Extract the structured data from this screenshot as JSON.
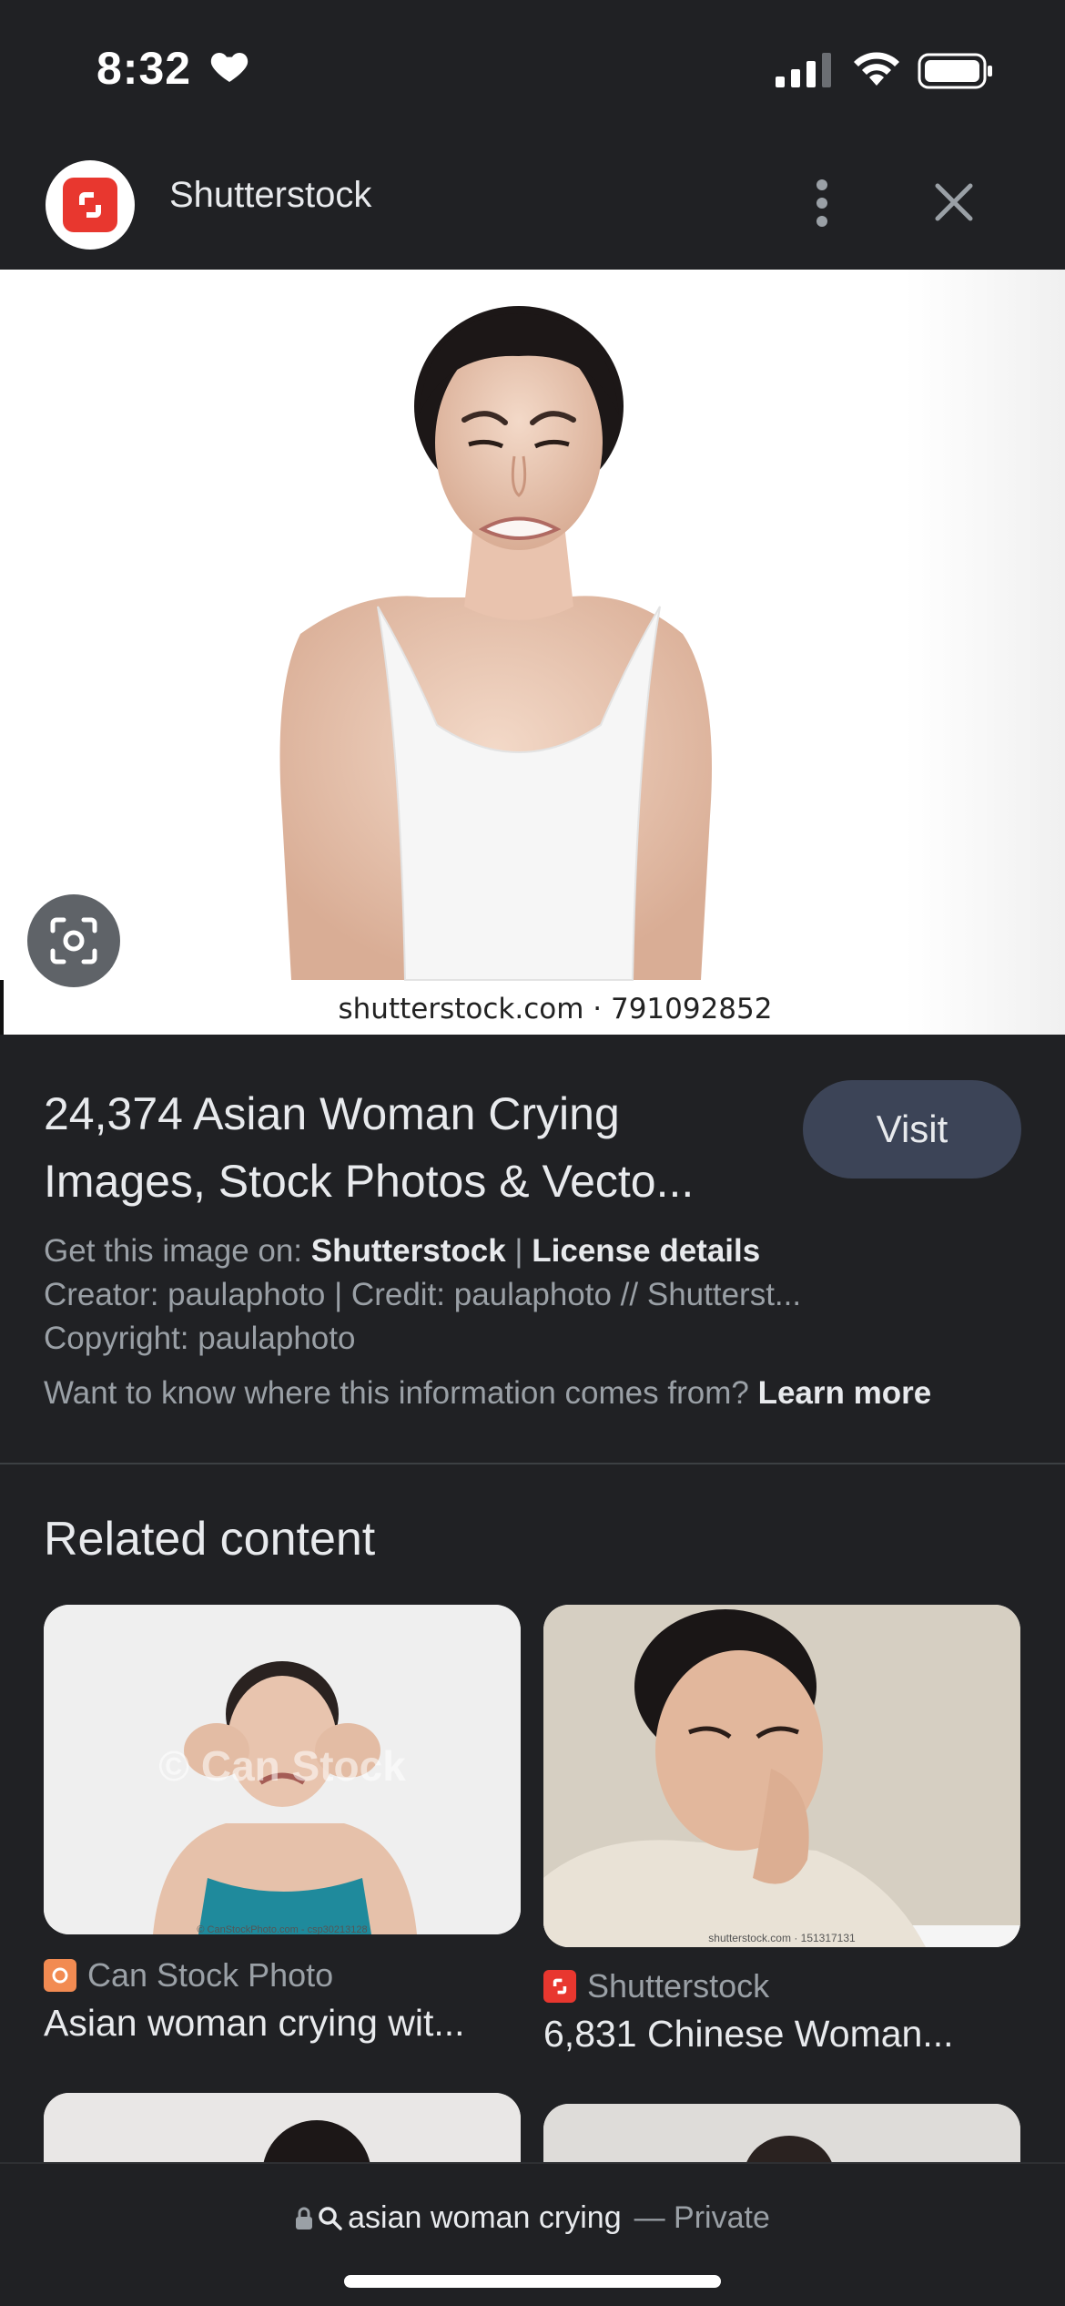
{
  "status_bar": {
    "time": "8:32",
    "icons": [
      "heart-icon",
      "signal-icon",
      "wifi-icon",
      "battery-icon"
    ]
  },
  "header": {
    "site_name": "Shutterstock",
    "logo_icon": "shutterstock-logo-icon",
    "more_icon": "more-vertical-icon",
    "close_icon": "close-icon"
  },
  "hero": {
    "watermark": "shutterstock.com · 791092852",
    "lens_icon": "lens-search-icon"
  },
  "result": {
    "title_line1": "24,374 Asian Woman Crying",
    "title_line2": "Images, Stock Photos & Vecto...",
    "visit_label": "Visit",
    "get_image_prefix": "Get this image on: ",
    "get_image_source": "Shutterstock",
    "separator": " | ",
    "license_label": "License details",
    "creator_line": "Creator: paulaphoto | Credit: paulaphoto // Shutterst...",
    "copyright_line": "Copyright: paulaphoto",
    "info_question": "Want to know where this information comes from? ",
    "learn_more": "Learn more"
  },
  "related": {
    "heading": "Related content",
    "cards": [
      {
        "source": "Can Stock Photo",
        "title": "Asian woman crying wit...",
        "watermark": "© Can Stock",
        "caption": "© CanStockPhoto.com - csp30213128"
      },
      {
        "source": "Shutterstock",
        "title": "6,831 Chinese Woman...",
        "caption": "shutterstock.com · 151317131"
      }
    ]
  },
  "bottom_bar": {
    "query": "asian woman crying",
    "mode": "— Private",
    "icons": [
      "lock-icon",
      "search-icon"
    ]
  },
  "colors": {
    "background": "#202124",
    "visit_button": "#3c4457",
    "shutterstock_red": "#e8372f",
    "canstock_orange": "#f28b52"
  }
}
